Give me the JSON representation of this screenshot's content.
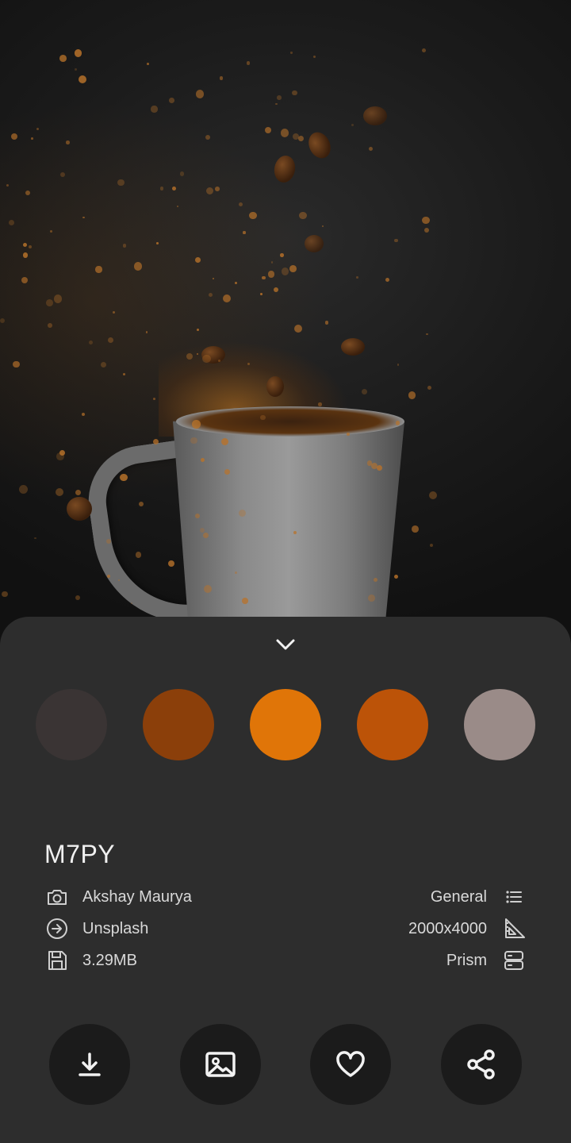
{
  "wallpaper": {
    "id": "M7PY"
  },
  "palette": {
    "colors": [
      "#3a3434",
      "#8b3f0a",
      "#e07508",
      "#bc5308",
      "#9a8b88"
    ]
  },
  "details": {
    "author": "Akshay Maurya",
    "source": "Unsplash",
    "size": "3.29MB",
    "category": "General",
    "resolution": "2000x4000",
    "provider": "Prism"
  },
  "icons": {
    "collapse": "chevron-down-icon",
    "author": "camera-icon",
    "source": "arrow-circle-icon",
    "size": "save-icon",
    "category": "list-icon",
    "resolution": "ruler-triangle-icon",
    "provider": "server-icon",
    "download": "download-icon",
    "set_wallpaper": "image-icon",
    "favorite": "heart-icon",
    "share": "share-icon"
  }
}
